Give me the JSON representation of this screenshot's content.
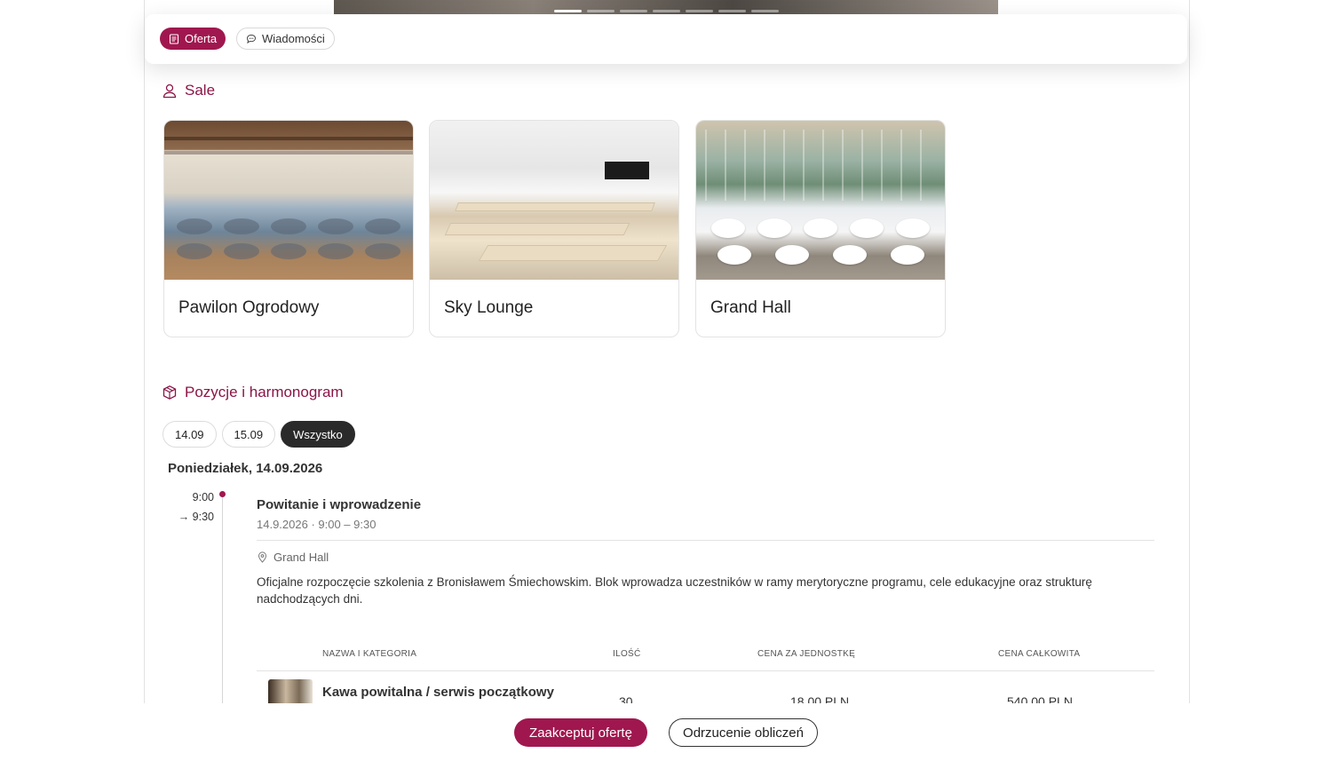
{
  "tabs": {
    "offer": "Oferta",
    "messages": "Wiadomości"
  },
  "rooms": {
    "heading": "Sale",
    "items": [
      {
        "name": "Pawilon Ogrodowy"
      },
      {
        "name": "Sky Lounge"
      },
      {
        "name": "Grand Hall"
      }
    ]
  },
  "schedule": {
    "heading": "Pozycje i harmonogram",
    "date_filters": [
      "14.09",
      "15.09",
      "Wszystko"
    ],
    "active_filter": "Wszystko",
    "day_title": "Poniedziałek, 14.09.2026",
    "event": {
      "start": "9:00",
      "end": "→ 9:30",
      "title": "Powitanie i wprowadzenie",
      "subtitle": "14.9.2026 · 9:00 – 9:30",
      "location": "Grand Hall",
      "description": "Oficjalne rozpoczęcie szkolenia z Bronisławem Śmiechowskim. Blok wprowadza uczestników w ramy merytoryczne programu, cele edukacyjne oraz strukturę nadchodzących dni."
    },
    "table": {
      "headers": [
        "NAZWA I KATEGORIA",
        "ILOŚĆ",
        "CENA ZA JEDNOSTKĘ",
        "CENA CAŁKOWITA"
      ],
      "rows": [
        {
          "name": "Kawa powitalna / serwis początkowy",
          "qty": "30",
          "unit_price": "18,00 PLN",
          "total": "540,00 PLN"
        }
      ]
    }
  },
  "footer": {
    "accept": "Zaakceptuj ofertę",
    "reject": "Odrzucenie obliczeń"
  },
  "colors": {
    "accent": "#a0174f",
    "heading": "#8b1547",
    "dark_pill": "#2a2a2a"
  },
  "icons": {
    "offer_tab": "document-icon",
    "messages_tab": "chat-bubble-icon",
    "rooms_heading": "person-icon",
    "schedule_heading": "box-icon",
    "location": "map-pin-icon"
  }
}
